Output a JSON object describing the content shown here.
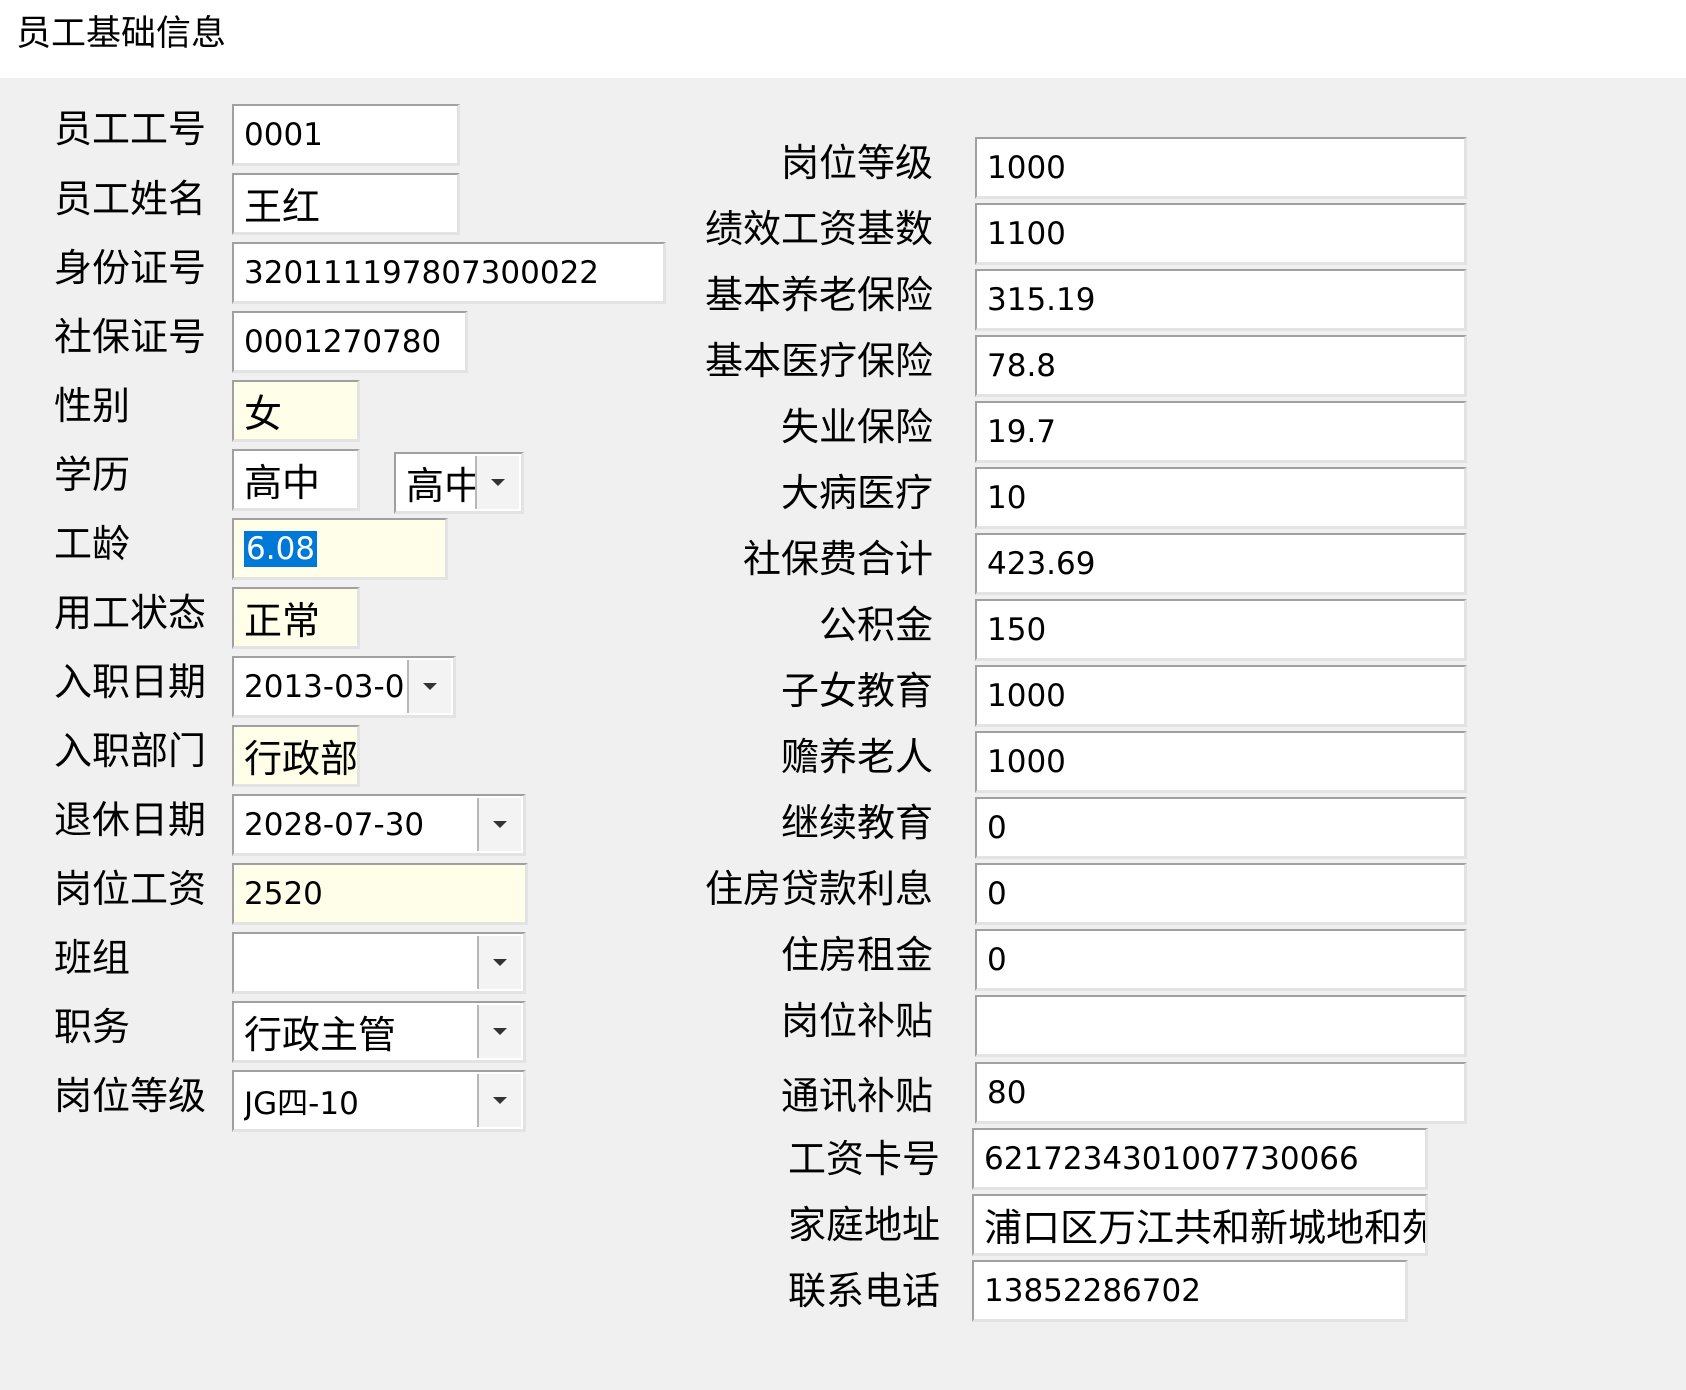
{
  "title": "员工基础信息",
  "icons": {
    "dropdown": "dropdown-arrow-icon"
  },
  "colors": {
    "highlight_bg": "#fffee8",
    "selection": "#0078d7",
    "panel_bg": "#f0f0f0"
  },
  "left": {
    "emp_no": {
      "label": "员工工号",
      "value": "0001"
    },
    "name": {
      "label": "员工姓名",
      "value": "王红"
    },
    "id_card": {
      "label": "身份证号",
      "value": "320111197807300022"
    },
    "ss_no": {
      "label": "社保证号",
      "value": "0001270780"
    },
    "gender": {
      "label": "性别",
      "value": "女"
    },
    "edu": {
      "label": "学历",
      "value": "高中",
      "select_value": "高中"
    },
    "seniority": {
      "label": "工龄",
      "value": "6.08"
    },
    "status": {
      "label": "用工状态",
      "value": "正常"
    },
    "hire_date": {
      "label": "入职日期",
      "value": "2013-03-0"
    },
    "dept": {
      "label": "入职部门",
      "value": "行政部"
    },
    "retire": {
      "label": "退休日期",
      "value": "2028-07-30"
    },
    "post_wage": {
      "label": "岗位工资",
      "value": "2520"
    },
    "team": {
      "label": "班组",
      "value": ""
    },
    "duty": {
      "label": "职务",
      "value": "行政主管"
    },
    "post_grade": {
      "label": "岗位等级",
      "value": "JG四-10"
    }
  },
  "right": {
    "post_grade": {
      "label": "岗位等级",
      "value": "1000"
    },
    "perf_base": {
      "label": "绩效工资基数",
      "value": "1100"
    },
    "pension": {
      "label": "基本养老保险",
      "value": "315.19"
    },
    "medical": {
      "label": "基本医疗保险",
      "value": "78.8"
    },
    "unemployment": {
      "label": "失业保险",
      "value": "19.7"
    },
    "serious": {
      "label": "大病医疗",
      "value": "10"
    },
    "ss_total": {
      "label": "社保费合计",
      "value": "423.69"
    },
    "fund": {
      "label": "公积金",
      "value": "150"
    },
    "child_edu": {
      "label": "子女教育",
      "value": "1000"
    },
    "elder": {
      "label": "赡养老人",
      "value": "1000"
    },
    "cont_edu": {
      "label": "继续教育",
      "value": "0"
    },
    "loan": {
      "label": "住房贷款利息",
      "value": "0"
    },
    "rent": {
      "label": "住房租金",
      "value": "0"
    },
    "post_allow": {
      "label": "岗位补贴",
      "value": ""
    },
    "comm_allow": {
      "label": "通讯补贴",
      "value": "80"
    },
    "card": {
      "label": "工资卡号",
      "value": "6217234301007730066"
    },
    "address": {
      "label": "家庭地址",
      "value": "浦口区万江共和新城地和苑"
    },
    "phone": {
      "label": "联系电话",
      "value": "13852286702"
    }
  }
}
